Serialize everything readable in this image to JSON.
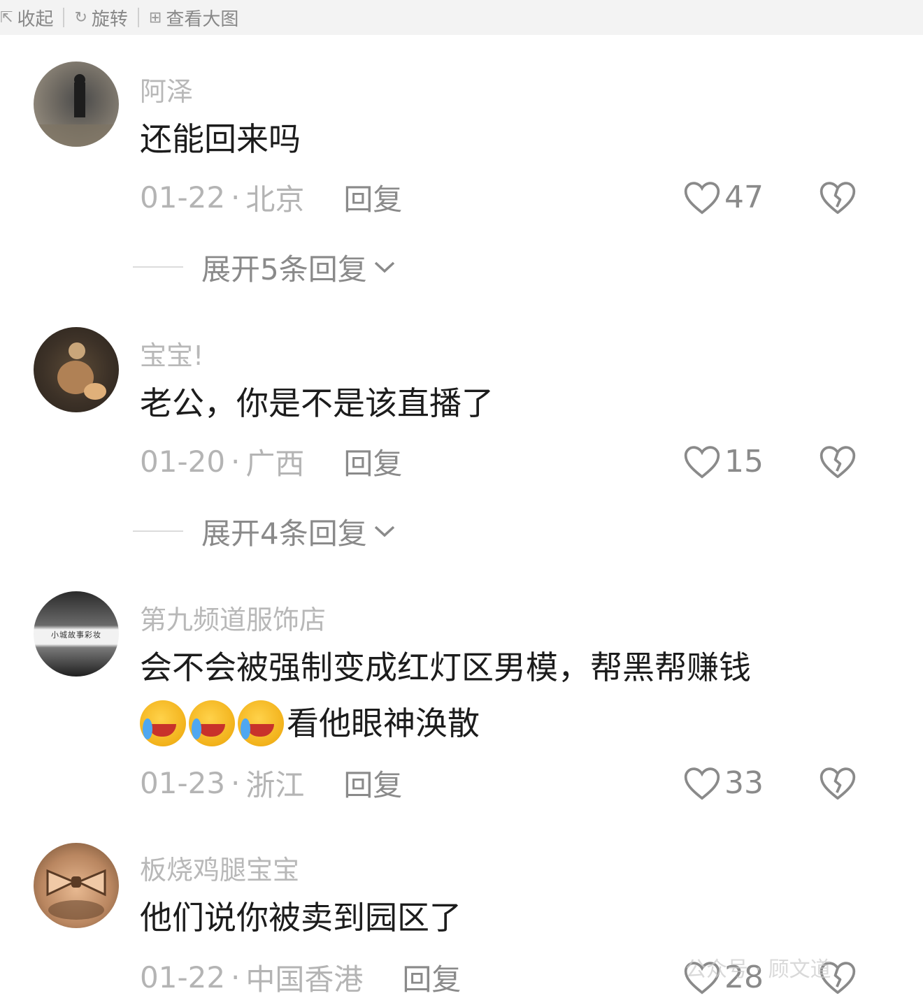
{
  "toolbar": {
    "collapse_label": "收起",
    "rotate_label": "旋转",
    "view_large_label": "查看大图"
  },
  "comments": [
    {
      "username": "阿泽",
      "text": [
        "还能回来吗"
      ],
      "date": "01-22",
      "location": "北京",
      "reply_label": "回复",
      "likes": "47",
      "expand_label": "展开5条回复"
    },
    {
      "username": "宝宝!",
      "text": [
        "老公，你是不是该直播了"
      ],
      "date": "01-20",
      "location": "广西",
      "reply_label": "回复",
      "likes": "15",
      "expand_label": "展开4条回复"
    },
    {
      "username": "第九频道服饰店",
      "avatar_text": "小城故事彩妆",
      "text": [
        "会不会被强制变成红灯区男模，帮黑帮赚钱",
        "看他眼神涣散"
      ],
      "emoji_count": 3,
      "date": "01-23",
      "location": "浙江",
      "reply_label": "回复",
      "likes": "33"
    },
    {
      "username": "板烧鸡腿宝宝",
      "text": [
        "他们说你被卖到园区了"
      ],
      "date": "01-22",
      "location": "中国香港",
      "reply_label": "回复",
      "likes": "28"
    }
  ],
  "meta_separator": "·",
  "watermark": "公众号 · 顾文道",
  "colors": {
    "username": "#b8b8b8",
    "text": "#1c1c1c",
    "meta": "#b4b4b4",
    "action": "#8a8a8a"
  }
}
